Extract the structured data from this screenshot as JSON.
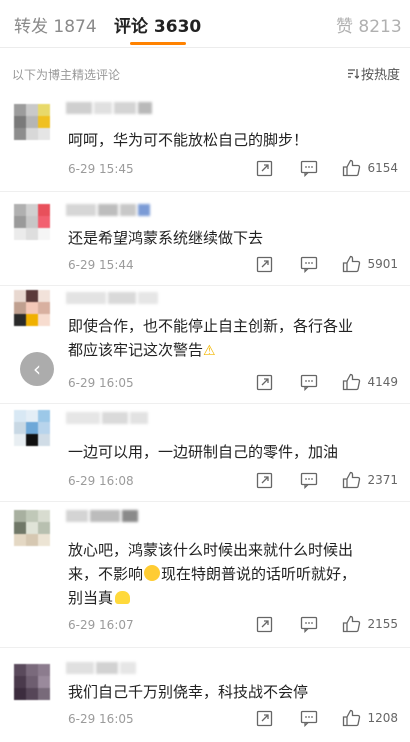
{
  "tabs": {
    "forward": "转发 1874",
    "comment": "评论 3630",
    "like": "赞 8213"
  },
  "subheader": {
    "text": "以下为博主精选评论",
    "sort_label": "按热度",
    "sort_icon": "sort-icon"
  },
  "comments": [
    {
      "text": "呵呵，华为可不能放松自己的脚步！",
      "time": "6-29 15:45",
      "likes": "6154"
    },
    {
      "text": "还是希望鸿蒙系统继续做下去",
      "time": "6-29 15:44",
      "likes": "5901"
    },
    {
      "text_line1": "即使合作，也不能停止自主创新，各行各业",
      "text_line2": "都应该牢记这次警告",
      "time": "6-29 16:05",
      "likes": "4149"
    },
    {
      "text": "一边可以用，一边研制自己的零件，加油",
      "time": "6-29 16:08",
      "likes": "2371"
    },
    {
      "text_line1": "放心吧，鸿蒙该什么时候出来就什么时候出",
      "text_line2a": "来，不影响",
      "text_line2b": "现在特朗普说的话听听就好，",
      "text_line3": "别当真",
      "time": "6-29 16:07",
      "likes": "2155"
    },
    {
      "text": "我们自己千万别侥幸，科技战不会停",
      "time": "6-29 16:05",
      "likes": "1208"
    }
  ],
  "colors": {
    "accent": "#ff8200",
    "text": "#222222",
    "muted": "#9b9b9b"
  }
}
